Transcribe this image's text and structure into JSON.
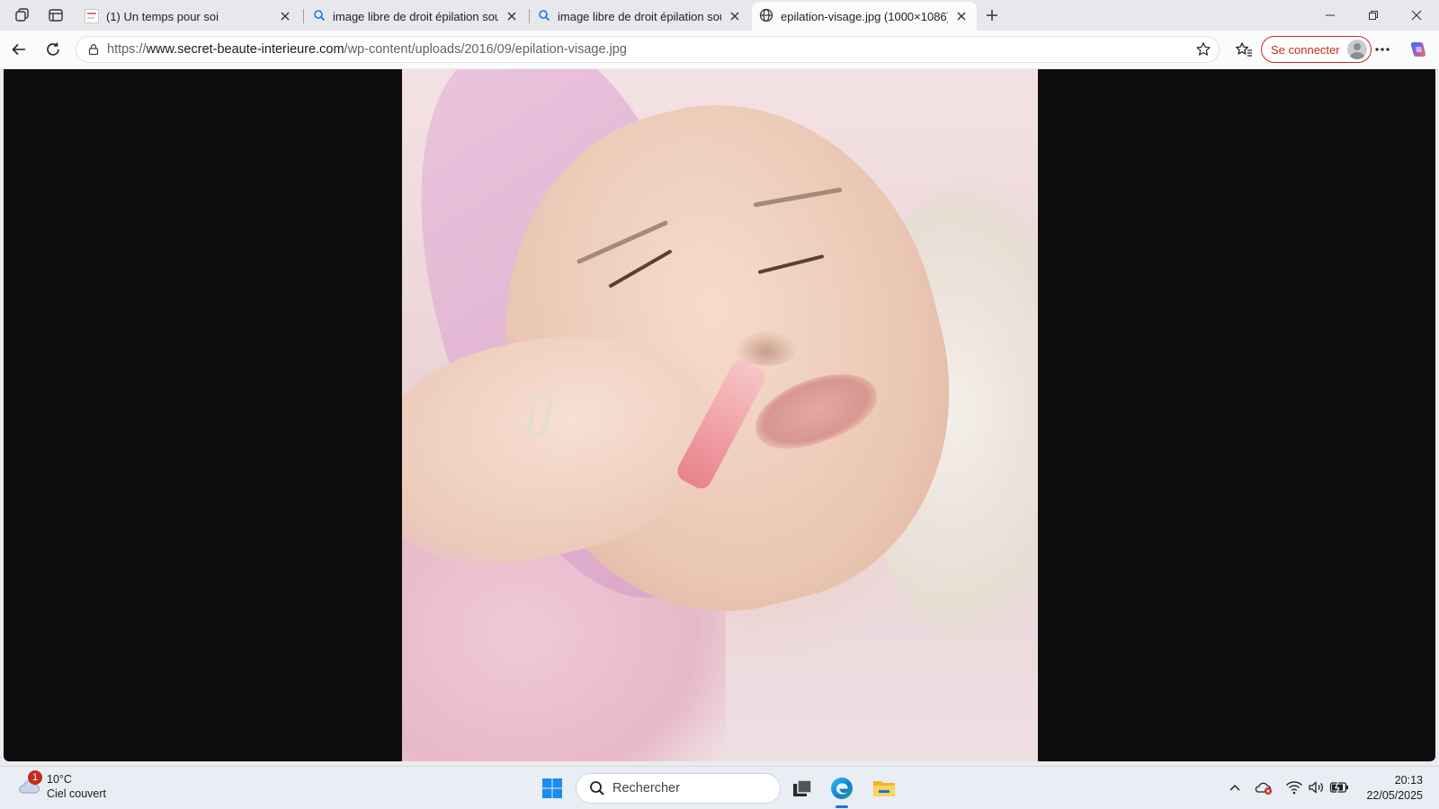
{
  "tabs": [
    {
      "title": "(1) Un temps pour soi",
      "icon": "page-icon"
    },
    {
      "title": "image libre de droit épilation sou",
      "icon": "search-icon"
    },
    {
      "title": "image libre de droit épilation sou",
      "icon": "search-icon"
    },
    {
      "title": "epilation-visage.jpg (1000×1086)",
      "icon": "globe-icon",
      "active": true
    }
  ],
  "address_bar": {
    "url_prefix": "https://",
    "url_host": "www.secret-beaute-interieure.com",
    "url_path": "/wp-content/uploads/2016/09/epilation-visage.jpg"
  },
  "profile": {
    "signin_label": "Se connecter"
  },
  "viewer": {
    "image_alt": "epilation-visage.jpg"
  },
  "taskbar": {
    "weather": {
      "temperature": "10°C",
      "condition": "Ciel couvert",
      "badge": "1"
    },
    "search_placeholder": "Rechercher",
    "time": "20:13",
    "date": "22/05/2025"
  },
  "colors": {
    "accent": "#c42b1c",
    "tab_active": "#fafbfc",
    "viewer_bg": "#0e0e0e"
  }
}
